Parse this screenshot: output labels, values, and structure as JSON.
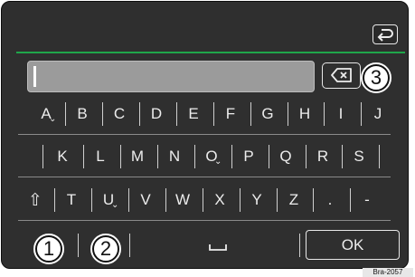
{
  "header": {
    "back_icon": "return-arrow-icon"
  },
  "input": {
    "value": ""
  },
  "delete_icon": "backspace-icon",
  "callouts": [
    "1",
    "2",
    "3"
  ],
  "rows": {
    "row1": [
      {
        "label": "A",
        "accent": "⌄"
      },
      {
        "label": "B"
      },
      {
        "label": "C"
      },
      {
        "label": "D"
      },
      {
        "label": "E"
      },
      {
        "label": "F"
      },
      {
        "label": "G"
      },
      {
        "label": "H"
      },
      {
        "label": "I"
      },
      {
        "label": "J"
      }
    ],
    "row2": [
      {
        "label": "K"
      },
      {
        "label": "L"
      },
      {
        "label": "M"
      },
      {
        "label": "N"
      },
      {
        "label": "O",
        "accent": "⌄"
      },
      {
        "label": "P"
      },
      {
        "label": "Q"
      },
      {
        "label": "R"
      },
      {
        "label": "S"
      }
    ],
    "row3": [
      {
        "label": "⇧"
      },
      {
        "label": "T"
      },
      {
        "label": "U",
        "accent": "⌄"
      },
      {
        "label": "V"
      },
      {
        "label": "W"
      },
      {
        "label": "X"
      },
      {
        "label": "Y"
      },
      {
        "label": "Z"
      },
      {
        "label": "."
      },
      {
        "label": "-"
      }
    ]
  },
  "bottom": {
    "space_icon": "space-bar-icon",
    "ok_label": "OK"
  },
  "figure_code": "Bra-2057",
  "colors": {
    "screen": "#2f2f2f",
    "accent_line": "#1fa64a",
    "input": "#9b9b9b"
  }
}
